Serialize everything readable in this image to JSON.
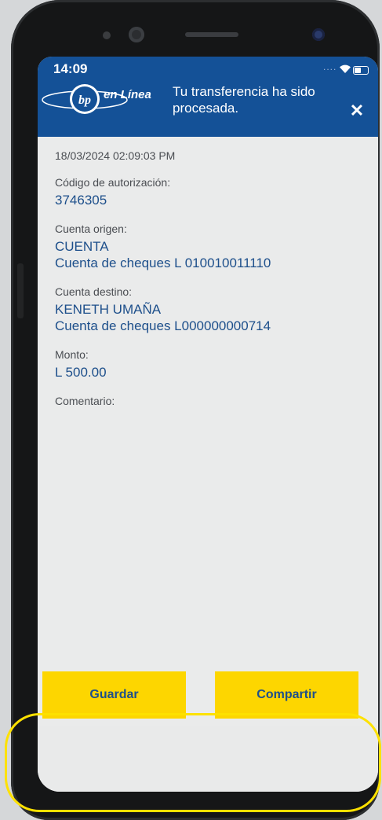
{
  "status": {
    "time": "14:09",
    "dots": "...."
  },
  "header": {
    "logo_text": "en Línea",
    "message": "Tu transferencia ha sido procesada.",
    "close_label": "✕"
  },
  "details": {
    "datetime": "18/03/2024 02:09:03 PM",
    "auth_label": "Código de autorización:",
    "auth_value": "3746305",
    "origin_label": "Cuenta origen:",
    "origin_name": "CUENTA",
    "origin_account": "Cuenta de cheques L 010010011110",
    "dest_label": "Cuenta destino:",
    "dest_name": "KENETH UMAÑA",
    "dest_account": "Cuenta de cheques L000000000714",
    "amount_label": "Monto:",
    "amount_value": "L 500.00",
    "comment_label": "Comentario:"
  },
  "actions": {
    "save_label": "Guardar",
    "share_label": "Compartir"
  },
  "colors": {
    "header_bg": "#145197",
    "button_bg": "#fdd600",
    "value_text": "#1d4f8b",
    "highlight": "#fde100"
  }
}
